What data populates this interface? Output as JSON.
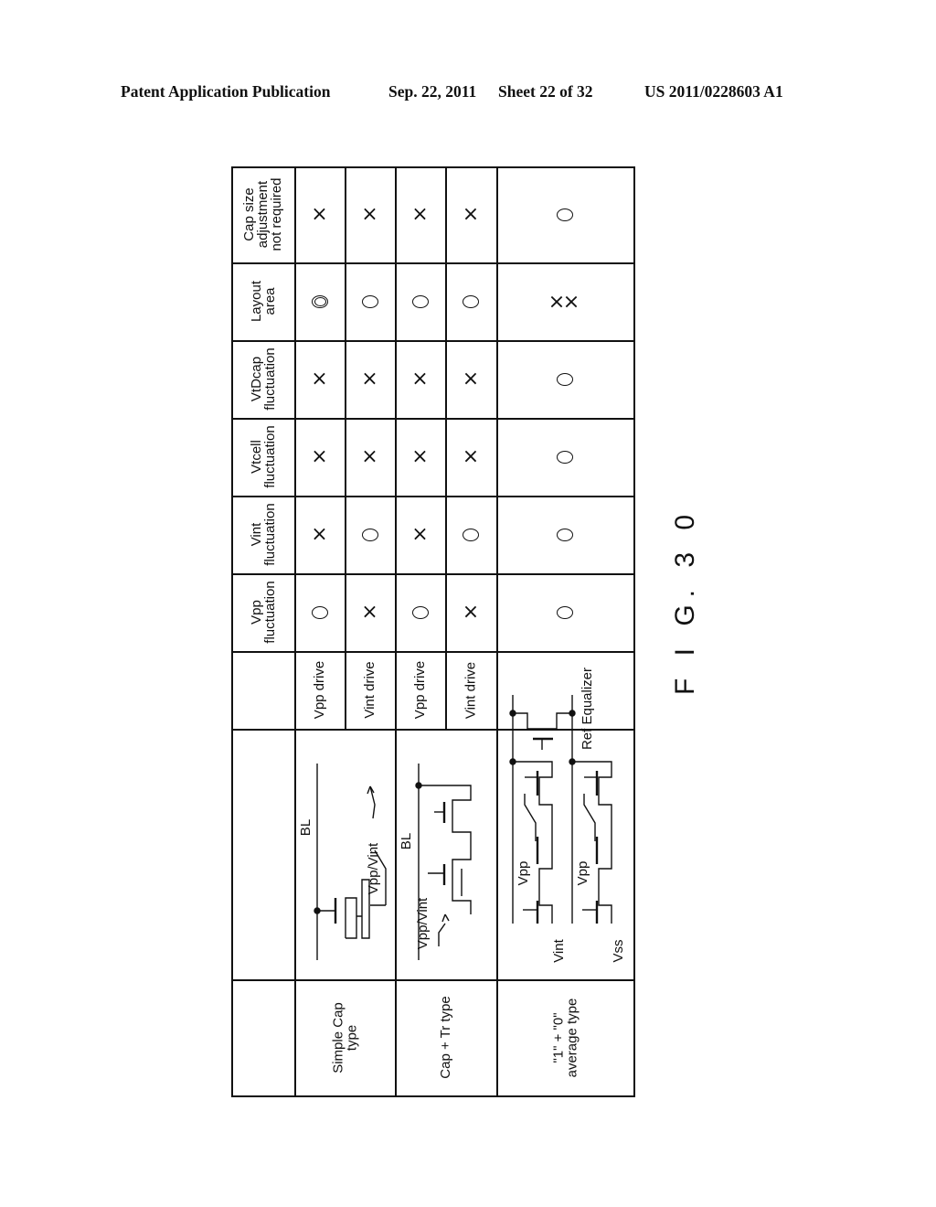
{
  "header": {
    "publication": "Patent Application Publication",
    "date": "Sep. 22, 2011",
    "sheet": "Sheet 22 of 32",
    "number": "US 2011/0228603 A1"
  },
  "figure_label": "F I G. 3 0",
  "table": {
    "criteria": [
      {
        "key": "cap_size",
        "label_lines": [
          "Cap size",
          "adjustment",
          "not required"
        ]
      },
      {
        "key": "layout_area",
        "label_lines": [
          "Layout",
          "area"
        ]
      },
      {
        "key": "vtdcap",
        "label_lines": [
          "VtDcap",
          "fluctuation"
        ]
      },
      {
        "key": "vtcell",
        "label_lines": [
          "Vtcell",
          "fluctuation"
        ]
      },
      {
        "key": "vint",
        "label_lines": [
          "Vint",
          "fluctuation"
        ]
      },
      {
        "key": "vpp",
        "label_lines": [
          "Vpp",
          "fluctuation"
        ]
      }
    ],
    "types": [
      {
        "name_lines": [
          "Simple Cap",
          "type"
        ],
        "circuit_labels": [
          "BL",
          "Vpp/Vint"
        ],
        "drives": [
          "Vpp drive",
          "Vint drive"
        ]
      },
      {
        "name_lines": [
          "Cap + Tr type"
        ],
        "circuit_labels": [
          "BL",
          "Vpp/Vint"
        ],
        "drives": [
          "Vpp drive",
          "Vint drive"
        ]
      },
      {
        "name_lines": [
          "\"1\" + \"0\"",
          "average type"
        ],
        "circuit_labels": [
          "Vpp",
          "Vpp",
          "Vint",
          "Vss",
          "Ref Equalizer"
        ],
        "drives": []
      }
    ],
    "rows": [
      {
        "variant": "Simple Cap type / Vpp drive",
        "cap_size": "×",
        "layout_area": "◎",
        "vtdcap": "×",
        "vtcell": "×",
        "vint": "×",
        "vpp": "○"
      },
      {
        "variant": "Simple Cap type / Vint drive",
        "cap_size": "×",
        "layout_area": "○",
        "vtdcap": "×",
        "vtcell": "×",
        "vint": "○",
        "vpp": "×"
      },
      {
        "variant": "Cap + Tr type / Vpp drive",
        "cap_size": "×",
        "layout_area": "○",
        "vtdcap": "×",
        "vtcell": "×",
        "vint": "×",
        "vpp": "○"
      },
      {
        "variant": "Cap + Tr type / Vint drive",
        "cap_size": "×",
        "layout_area": "○",
        "vtdcap": "×",
        "vtcell": "×",
        "vint": "○",
        "vpp": "×"
      },
      {
        "variant": "\"1\" + \"0\" average type",
        "cap_size": "○",
        "layout_area": "××",
        "vtdcap": "○",
        "vtcell": "○",
        "vint": "○",
        "vpp": "○"
      }
    ]
  }
}
